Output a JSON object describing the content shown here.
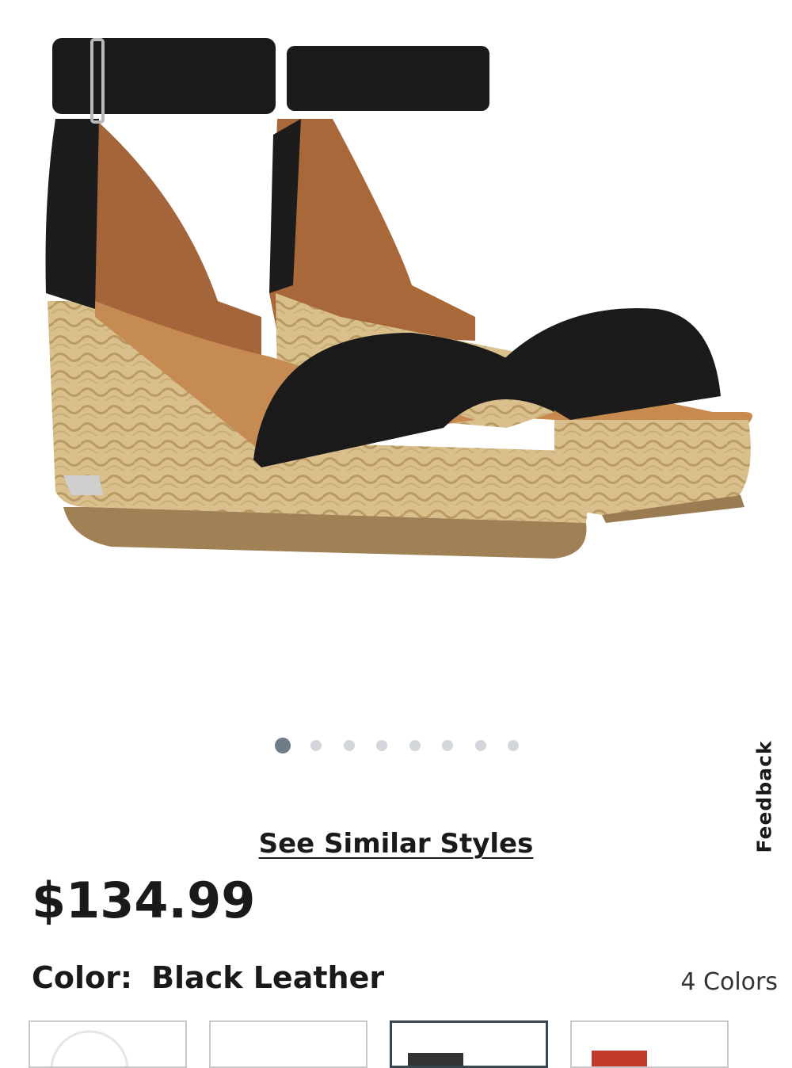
{
  "product": {
    "image_alt": "black leather espadrille wedge sandal with ankle strap",
    "carousel": {
      "total": 8,
      "active_index": 0
    },
    "feedback_label": "Feedback",
    "see_similar_label": "See Similar Styles",
    "price": "$134.99",
    "color_label": "Color:",
    "color_value": "Black Leather",
    "colors_count": "4 Colors",
    "swatches": [
      {
        "name": "swatch-1",
        "selected": false,
        "accent": "#e6e6e6"
      },
      {
        "name": "swatch-2",
        "selected": false,
        "accent": "#ffffff"
      },
      {
        "name": "swatch-3",
        "selected": true,
        "accent": "#333333"
      },
      {
        "name": "swatch-4",
        "selected": false,
        "accent": "#c0392b"
      }
    ]
  }
}
